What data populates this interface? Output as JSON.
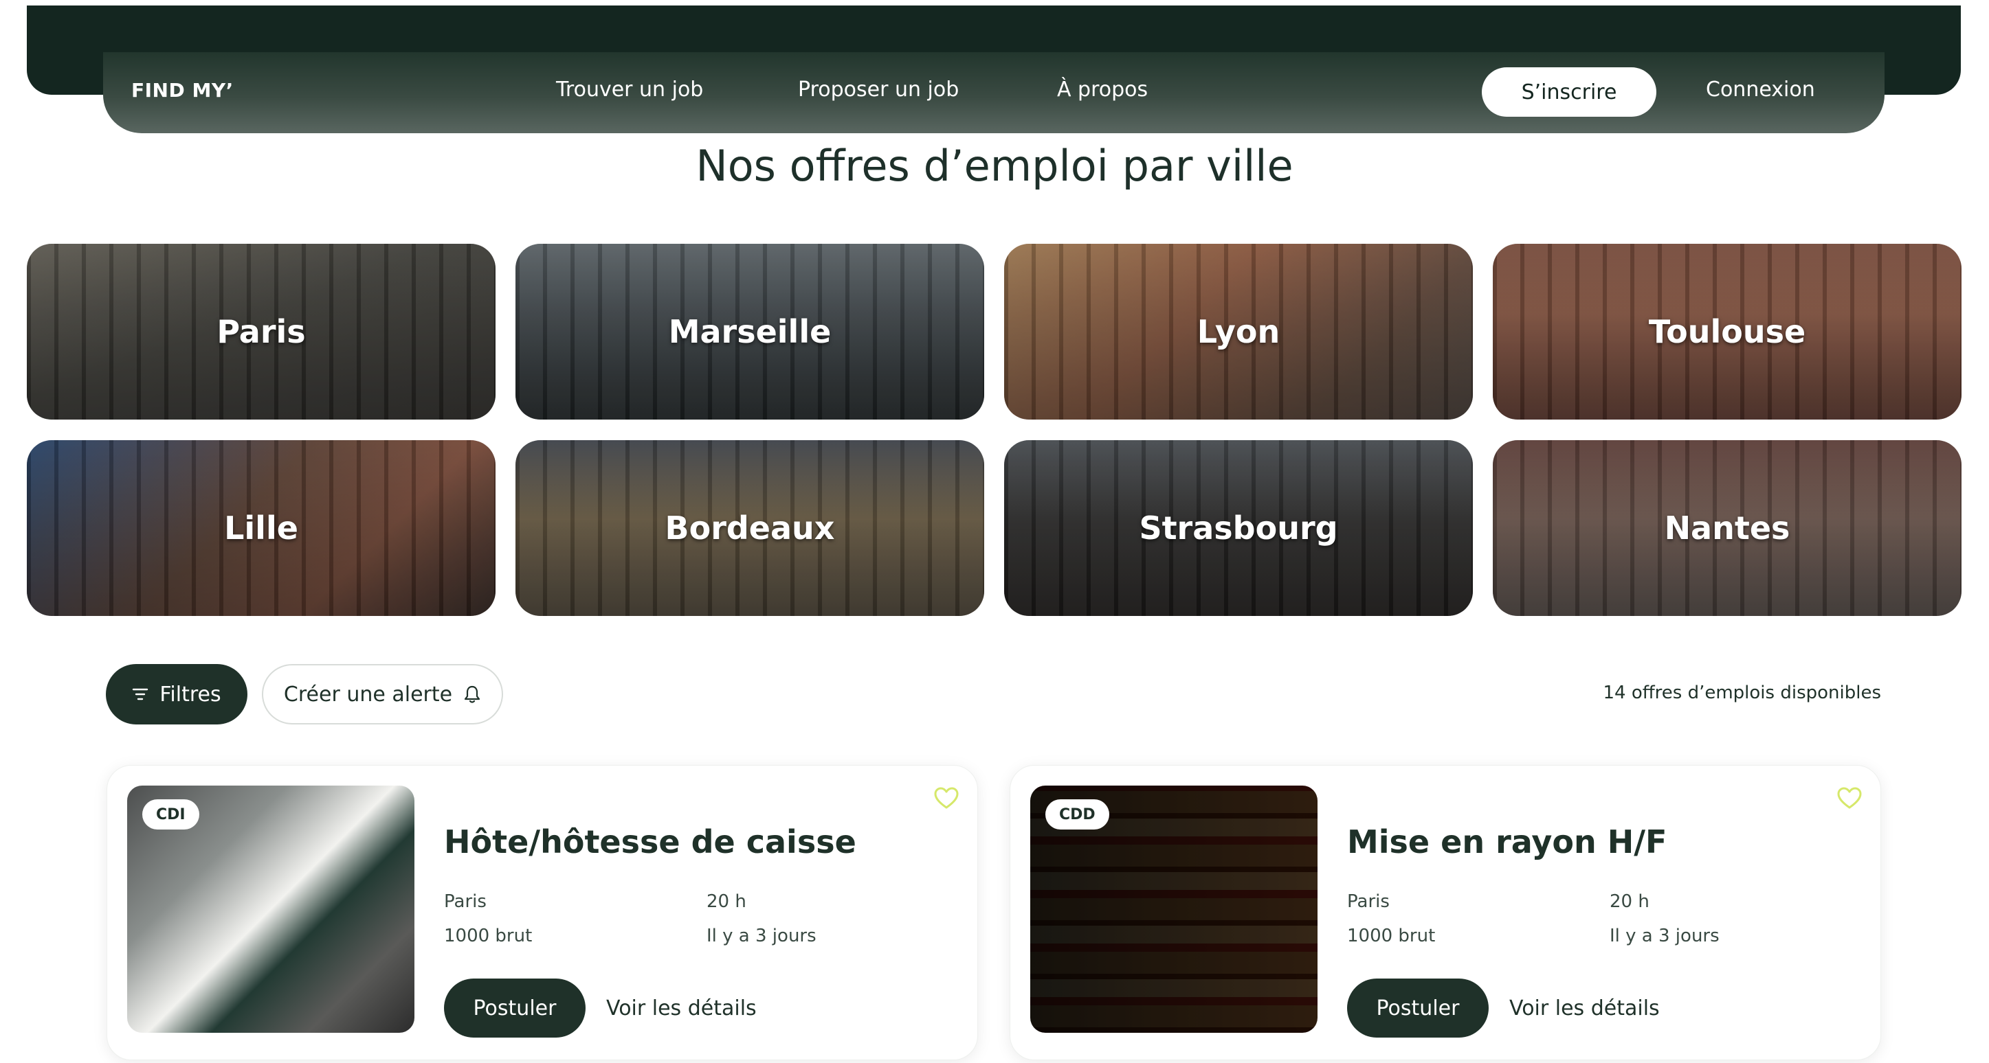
{
  "header": {
    "logo": "FIND MY’",
    "nav": [
      "Trouver un job",
      "Proposer un job",
      "À propos"
    ],
    "signup": "S’inscrire",
    "login": "Connexion"
  },
  "page_title": "Nos offres d’emploi par ville",
  "cities": [
    "Paris",
    "Marseille",
    "Lyon",
    "Toulouse",
    "Lille",
    "Bordeaux",
    "Strasbourg",
    "Nantes"
  ],
  "filters": {
    "filters_label": "Filtres",
    "alert_label": "Créer une alerte",
    "count_text": "14 offres d’emplois disponibles"
  },
  "jobs": [
    {
      "contract": "CDI",
      "title": "Hôte/hôtesse de caisse",
      "city": "Paris",
      "hours": "20 h",
      "salary": "1000 brut",
      "posted": "Il y a 3 jours",
      "apply": "Postuler",
      "details": "Voir les détails"
    },
    {
      "contract": "CDD",
      "title": "Mise en rayon H/F",
      "city": "Paris",
      "hours": "20 h",
      "salary": "1000 brut",
      "posted": "Il y a 3 jours",
      "apply": "Postuler",
      "details": "Voir les détails"
    }
  ],
  "colors": {
    "brand_dark": "#1f3129",
    "heart_accent": "#d6e86a"
  }
}
